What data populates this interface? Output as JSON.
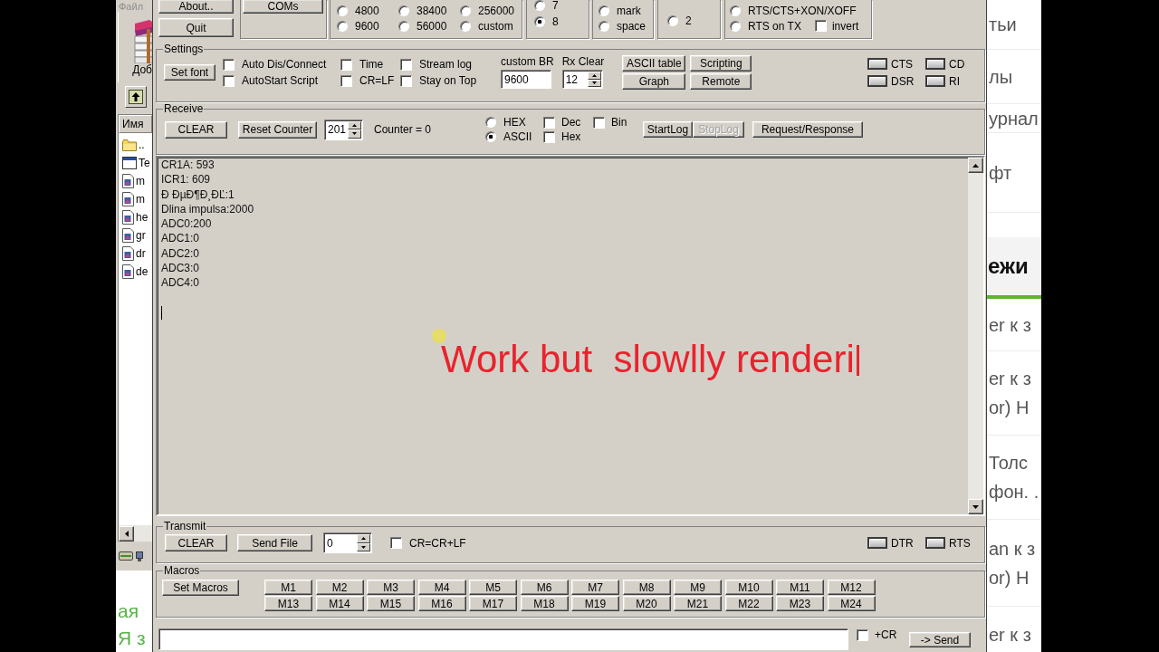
{
  "file_manager": {
    "menu": [
      "Файл"
    ],
    "toolbar_label": "Доб",
    "column_header": "Имя",
    "items": [
      {
        "kind": "folder",
        "name": ".."
      },
      {
        "kind": "window",
        "name": "Te"
      },
      {
        "kind": "file",
        "name": "m"
      },
      {
        "kind": "file",
        "name": "m"
      },
      {
        "kind": "file",
        "name": "he"
      },
      {
        "kind": "file",
        "name": "gr"
      },
      {
        "kind": "file",
        "name": "dr"
      },
      {
        "kind": "file",
        "name": "de"
      }
    ]
  },
  "page_fragment": {
    "lines": [
      "ая",
      "Я з"
    ]
  },
  "terminal": {
    "top_buttons": [
      "About..",
      "Quit"
    ],
    "coms_button": "COMs",
    "baud_rate": [
      {
        "label": "4800",
        "selected": false
      },
      {
        "label": "38400",
        "selected": false
      },
      {
        "label": "256000",
        "selected": false
      },
      {
        "label": "9600",
        "selected": false
      },
      {
        "label": "56000",
        "selected": false
      },
      {
        "label": "custom",
        "selected": false
      }
    ],
    "data_bits": [
      {
        "label": "7",
        "selected": false
      },
      {
        "label": "8",
        "selected": true
      }
    ],
    "parity": [
      {
        "label": "mark",
        "selected": false
      },
      {
        "label": "space",
        "selected": false
      }
    ],
    "stop_bits": [
      {
        "label": "2",
        "selected": false
      }
    ],
    "handshaking": [
      {
        "label": "RTS/CTS+XON/XOFF",
        "selected": false
      },
      {
        "label": "RTS on TX",
        "selected": false
      }
    ],
    "invert": {
      "label": "invert",
      "checked": false
    },
    "settings": {
      "title": "Settings",
      "set_font": "Set font",
      "options": [
        {
          "label": "Auto Dis/Connect",
          "checked": false
        },
        {
          "label": "Time",
          "checked": false
        },
        {
          "label": "Stream log",
          "checked": false
        },
        {
          "label": "AutoStart Script",
          "checked": false
        },
        {
          "label": "CR=LF",
          "checked": false
        },
        {
          "label": "Stay on Top",
          "checked": false
        }
      ],
      "custom_br": {
        "label": "custom BR",
        "value": "9600"
      },
      "rx_clear": {
        "label": "Rx Clear",
        "value": "12"
      },
      "tools": [
        "ASCII table",
        "Scripting",
        "Graph",
        "Remote"
      ],
      "signals": [
        {
          "label": "CTS",
          "on": false
        },
        {
          "label": "CD",
          "on": false
        },
        {
          "label": "DSR",
          "on": false
        },
        {
          "label": "RI",
          "on": false
        }
      ]
    },
    "receive": {
      "title": "Receive",
      "clear_button": "CLEAR",
      "reset_button": "Reset Counter",
      "counter_value": "201",
      "counter_label": "Counter = 0",
      "display": [
        {
          "label": "HEX",
          "selected": false
        },
        {
          "label": "ASCII",
          "selected": true
        }
      ],
      "formats": [
        {
          "label": "Dec",
          "checked": false
        },
        {
          "label": "Bin",
          "checked": false
        },
        {
          "label": "Hex",
          "checked": false
        }
      ],
      "log_buttons": [
        {
          "label": "StartLog",
          "disabled": false
        },
        {
          "label": "StopLog",
          "disabled": true
        }
      ],
      "request_button": "Request/Response",
      "lines": [
        "CR1A: 593",
        "ICR1: 609",
        "Đ ĐµĐ¶Đ¸ĐĽ:1",
        "Dlina impulsa:2000",
        "ADC0:200",
        "ADC1:0",
        "ADC2:0",
        "ADC3:0",
        "ADC4:0"
      ],
      "overlay_caption": "Work but  slowlly renderi"
    },
    "transmit": {
      "title": "Transmit",
      "clear_button": "CLEAR",
      "send_file_button": "Send File",
      "delay_value": "0",
      "cr_option": {
        "label": "CR=CR+LF",
        "checked": false
      },
      "signals": [
        {
          "label": "DTR",
          "on": false
        },
        {
          "label": "RTS",
          "on": false
        }
      ]
    },
    "macros": {
      "title": "Macros",
      "set_button": "Set Macros",
      "buttons": [
        "M1",
        "M2",
        "M3",
        "M4",
        "M5",
        "M6",
        "M7",
        "M8",
        "M9",
        "M10",
        "M11",
        "M12",
        "M13",
        "M14",
        "M15",
        "M16",
        "M17",
        "M18",
        "M19",
        "M20",
        "M21",
        "M22",
        "M23",
        "M24"
      ]
    },
    "send_bar": {
      "plus_cr": {
        "label": "+CR",
        "checked": false
      },
      "send_button": "-> Send"
    }
  },
  "web_page": {
    "menu_items": [
      "тьи",
      "лы",
      "урнал",
      "фт"
    ],
    "section_title": "ежи",
    "articles": [
      {
        "lines": [
          "er к з"
        ]
      },
      {
        "lines": [
          "er к з",
          "or) H"
        ]
      },
      {
        "lines": [
          "Толс",
          "фон. ."
        ]
      },
      {
        "lines": [
          "an к з",
          "or) H"
        ]
      },
      {
        "lines": [
          "er к з"
        ]
      }
    ]
  }
}
